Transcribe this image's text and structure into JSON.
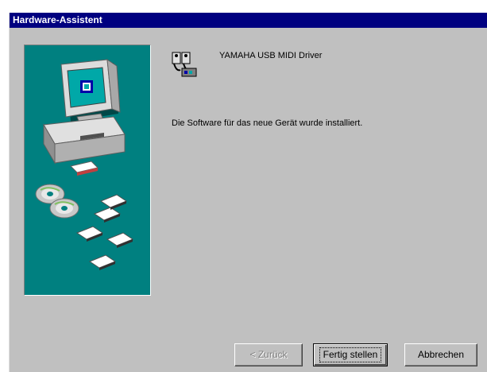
{
  "window": {
    "title": "Hardware-Assistent"
  },
  "device": {
    "name": "YAMAHA USB MIDI Driver",
    "icon": "midi-device-icon"
  },
  "main": {
    "message": "Die Software für das neue Gerät wurde installiert."
  },
  "buttons": {
    "back_label": "< Zurück",
    "finish_label": "Fertig stellen",
    "cancel_label": "Abbrechen"
  },
  "colors": {
    "titlebar": "#000080",
    "dialog_background": "#c0c0c0",
    "illustration_background": "#008080"
  }
}
